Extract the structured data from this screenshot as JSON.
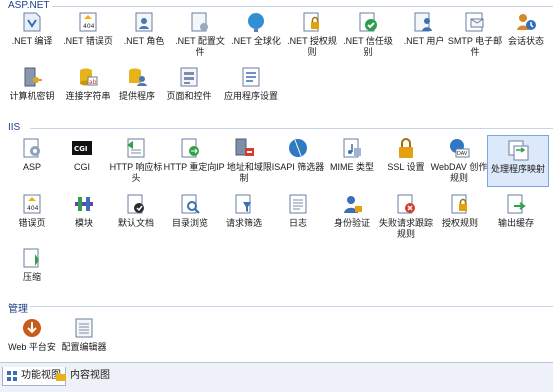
{
  "sections": [
    {
      "title": "ASP.NET",
      "tiles": [
        {
          "label": ".NET 编译"
        },
        {
          "label": ".NET 错误页"
        },
        {
          "label": ".NET 角色"
        },
        {
          "label": ".NET 配置文件"
        },
        {
          "label": ".NET 全球化"
        },
        {
          "label": ".NET 授权规则"
        },
        {
          "label": ".NET 信任级别"
        },
        {
          "label": ".NET 用户"
        },
        {
          "label": "SMTP 电子邮件"
        },
        {
          "label": "会话状态"
        },
        {
          "label": "计算机密钥"
        },
        {
          "label": "连接字符串"
        },
        {
          "label": "提供程序"
        },
        {
          "label": "页面和控件"
        },
        {
          "label": "应用程序设置"
        }
      ]
    },
    {
      "title": "IIS",
      "tiles": [
        {
          "label": "ASP"
        },
        {
          "label": "CGI"
        },
        {
          "label": "HTTP 响应标头"
        },
        {
          "label": "HTTP 重定向"
        },
        {
          "label": "IP 地址和域限制"
        },
        {
          "label": "ISAPI 筛选器"
        },
        {
          "label": "MIME 类型"
        },
        {
          "label": "SSL 设置"
        },
        {
          "label": "WebDAV 创作规则"
        },
        {
          "label": "处理程序映射"
        },
        {
          "label": "错误页"
        },
        {
          "label": "模块"
        },
        {
          "label": "默认文档"
        },
        {
          "label": "目录浏览"
        },
        {
          "label": "请求筛选"
        },
        {
          "label": "日志"
        },
        {
          "label": "身份验证"
        },
        {
          "label": "失败请求跟踪规则"
        },
        {
          "label": "授权规则"
        },
        {
          "label": "输出缓存"
        },
        {
          "label": "压缩"
        }
      ]
    },
    {
      "title": "管理",
      "tiles": [
        {
          "label": "Web 平台安"
        },
        {
          "label": "配置编辑器"
        }
      ]
    }
  ],
  "tabs": [
    {
      "label": "功能视图"
    },
    {
      "label": "内容视图"
    }
  ],
  "colors": {
    "section_header": "#1e3f8a",
    "selected_bg": "#dbe9fb",
    "tabbar_bg": "#eef2f8"
  }
}
